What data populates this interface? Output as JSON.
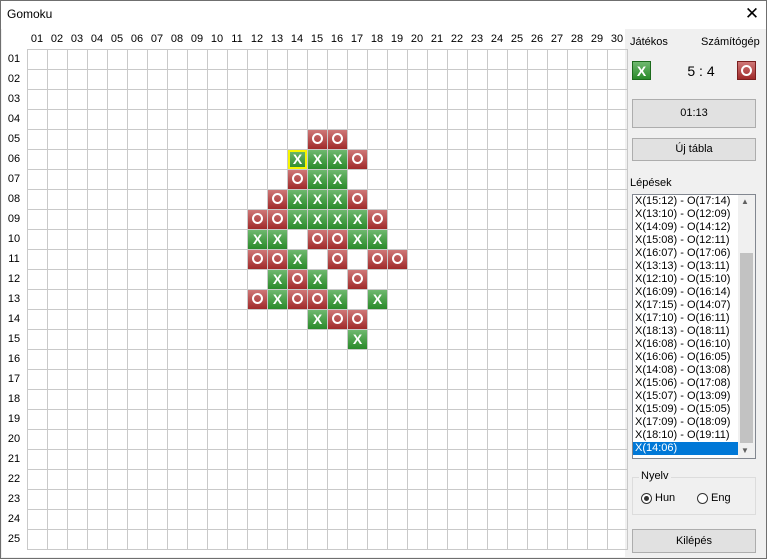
{
  "window": {
    "title": "Gomoku",
    "close_glyph": "✕"
  },
  "board": {
    "col_labels": [
      "01",
      "02",
      "03",
      "04",
      "05",
      "06",
      "07",
      "08",
      "09",
      "10",
      "11",
      "12",
      "13",
      "14",
      "15",
      "16",
      "17",
      "18",
      "19",
      "20",
      "21",
      "22",
      "23",
      "24",
      "25",
      "26",
      "27",
      "28",
      "29",
      "30"
    ],
    "row_labels": [
      "01",
      "02",
      "03",
      "04",
      "05",
      "06",
      "07",
      "08",
      "09",
      "10",
      "11",
      "12",
      "13",
      "14",
      "15",
      "16",
      "17",
      "18",
      "19",
      "20",
      "21",
      "22",
      "23",
      "24",
      "25"
    ],
    "pieces": [
      {
        "c": 15,
        "r": 5,
        "p": "O"
      },
      {
        "c": 16,
        "r": 5,
        "p": "O"
      },
      {
        "c": 14,
        "r": 6,
        "p": "X",
        "last": true
      },
      {
        "c": 15,
        "r": 6,
        "p": "X"
      },
      {
        "c": 16,
        "r": 6,
        "p": "X"
      },
      {
        "c": 17,
        "r": 6,
        "p": "O"
      },
      {
        "c": 14,
        "r": 7,
        "p": "O"
      },
      {
        "c": 15,
        "r": 7,
        "p": "X"
      },
      {
        "c": 16,
        "r": 7,
        "p": "X"
      },
      {
        "c": 13,
        "r": 8,
        "p": "O"
      },
      {
        "c": 14,
        "r": 8,
        "p": "X"
      },
      {
        "c": 15,
        "r": 8,
        "p": "X"
      },
      {
        "c": 16,
        "r": 8,
        "p": "X"
      },
      {
        "c": 17,
        "r": 8,
        "p": "O"
      },
      {
        "c": 12,
        "r": 9,
        "p": "O"
      },
      {
        "c": 13,
        "r": 9,
        "p": "O"
      },
      {
        "c": 14,
        "r": 9,
        "p": "X"
      },
      {
        "c": 15,
        "r": 9,
        "p": "X"
      },
      {
        "c": 16,
        "r": 9,
        "p": "X"
      },
      {
        "c": 17,
        "r": 9,
        "p": "X"
      },
      {
        "c": 18,
        "r": 9,
        "p": "O"
      },
      {
        "c": 12,
        "r": 10,
        "p": "X"
      },
      {
        "c": 13,
        "r": 10,
        "p": "X"
      },
      {
        "c": 15,
        "r": 10,
        "p": "O"
      },
      {
        "c": 16,
        "r": 10,
        "p": "O"
      },
      {
        "c": 17,
        "r": 10,
        "p": "X"
      },
      {
        "c": 18,
        "r": 10,
        "p": "X"
      },
      {
        "c": 12,
        "r": 11,
        "p": "O"
      },
      {
        "c": 13,
        "r": 11,
        "p": "O"
      },
      {
        "c": 14,
        "r": 11,
        "p": "X"
      },
      {
        "c": 16,
        "r": 11,
        "p": "O"
      },
      {
        "c": 18,
        "r": 11,
        "p": "O"
      },
      {
        "c": 19,
        "r": 11,
        "p": "O"
      },
      {
        "c": 13,
        "r": 12,
        "p": "X"
      },
      {
        "c": 14,
        "r": 12,
        "p": "O"
      },
      {
        "c": 15,
        "r": 12,
        "p": "X"
      },
      {
        "c": 17,
        "r": 12,
        "p": "O"
      },
      {
        "c": 12,
        "r": 13,
        "p": "O"
      },
      {
        "c": 13,
        "r": 13,
        "p": "X"
      },
      {
        "c": 14,
        "r": 13,
        "p": "O"
      },
      {
        "c": 15,
        "r": 13,
        "p": "O"
      },
      {
        "c": 16,
        "r": 13,
        "p": "X"
      },
      {
        "c": 18,
        "r": 13,
        "p": "X"
      },
      {
        "c": 15,
        "r": 14,
        "p": "X"
      },
      {
        "c": 16,
        "r": 14,
        "p": "O"
      },
      {
        "c": 17,
        "r": 14,
        "p": "O"
      },
      {
        "c": 17,
        "r": 15,
        "p": "X"
      }
    ]
  },
  "side": {
    "player_label": "Játékos",
    "computer_label": "Számítógép",
    "player_symbol": "X",
    "score": "5 : 4",
    "timer": "01:13",
    "new_board_label": "Új tábla",
    "moves_label": "Lépések",
    "moves": [
      "X(15:12) - O(17:14)",
      "X(13:10) - O(12:09)",
      "X(14:09) - O(14:12)",
      "X(15:08) - O(12:11)",
      "X(16:07) - O(17:06)",
      "X(13:13) - O(13:11)",
      "X(12:10) - O(15:10)",
      "X(16:09) - O(16:14)",
      "X(17:15) - O(14:07)",
      "X(17:10) - O(16:11)",
      "X(18:13) - O(18:11)",
      "X(16:08) - O(16:10)",
      "X(16:06) - O(16:05)",
      "X(14:08) - O(13:08)",
      "X(15:06) - O(17:08)",
      "X(15:07) - O(13:09)",
      "X(15:09) - O(15:05)",
      "X(17:09) - O(18:09)",
      "X(18:10) - O(19:11)",
      "X(14:06)"
    ],
    "language_label": "Nyelv",
    "lang_hun": "Hun",
    "lang_eng": "Eng",
    "lang_selected": "Hun",
    "exit_label": "Kilépés"
  },
  "colors": {
    "x_piece": "#2a8a2a",
    "o_piece": "#a02a2a",
    "selected": "#0078d7",
    "last_move": "#f5f500"
  }
}
